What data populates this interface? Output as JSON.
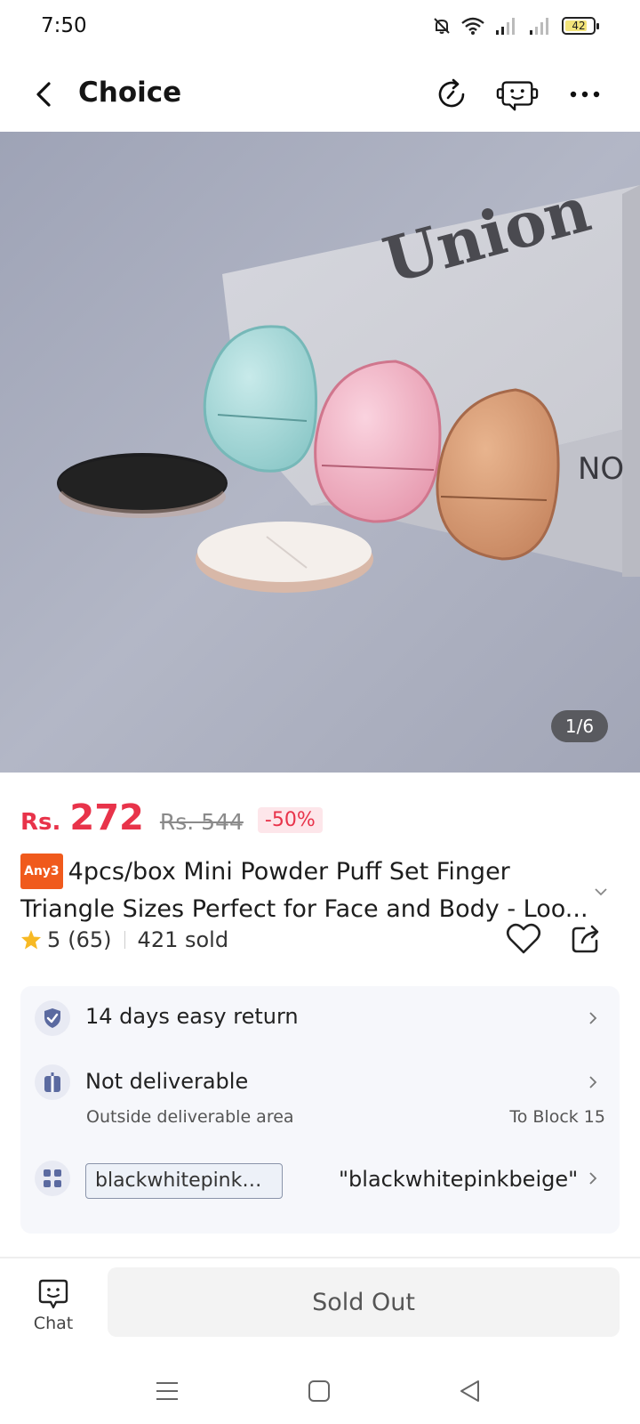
{
  "status_bar": {
    "time": "7:50",
    "battery_level": "42",
    "icons": [
      "mute-bell-icon",
      "wifi-icon",
      "signal-icon",
      "signal-icon",
      "battery-icon"
    ]
  },
  "header": {
    "title": "Choice",
    "icons": [
      "back-chevron-icon",
      "history-refresh-icon",
      "support-robot-icon",
      "more-dots-icon"
    ]
  },
  "gallery": {
    "counter": "1/6",
    "book_text": "Union",
    "book_side_text": "NO"
  },
  "price": {
    "currency": "Rs.",
    "current": "272",
    "original": "Rs. 544",
    "discount": "-50%",
    "accent_color": "#e8334a"
  },
  "product": {
    "tag": "Any3",
    "title_line1": "4pcs/box Mini Powder Puff Set Finger",
    "title_line2": "Triangle Sizes Perfect for Face and Body - Loo..."
  },
  "rating": {
    "score": "5",
    "count": "(65)",
    "sold": "421 sold"
  },
  "info": {
    "return": "14 days easy return",
    "delivery_title": "Not deliverable",
    "delivery_sub": "Outside deliverable area",
    "delivery_dest": "To Block 15",
    "variant_chip": "blackwhitepinkbeige",
    "variant_value": "\"blackwhitepinkbeige\""
  },
  "bottom_bar": {
    "chat_label": "Chat",
    "action_label": "Sold Out"
  },
  "nav_bar": {
    "icons": [
      "menu-icon",
      "home-square-icon",
      "back-triangle-icon"
    ]
  }
}
